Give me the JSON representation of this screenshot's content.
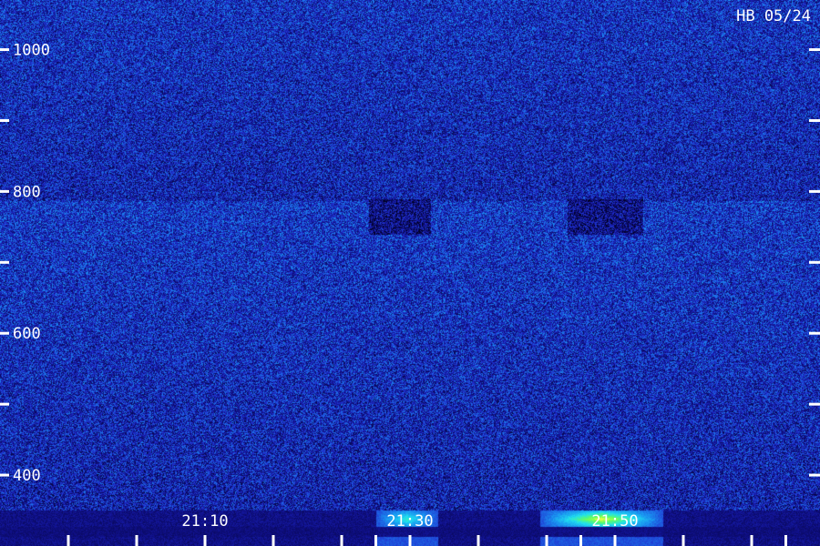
{
  "chart_data": {
    "type": "heatmap",
    "title": "",
    "station_label": "HB 05/24",
    "xlabel": "",
    "ylabel": "",
    "y_range": [
      300,
      1070
    ],
    "y_ticks": [
      {
        "value": 1000,
        "label": "1000"
      },
      {
        "value": 900,
        "label": ""
      },
      {
        "value": 800,
        "label": "800"
      },
      {
        "value": 700,
        "label": ""
      },
      {
        "value": 600,
        "label": "600"
      },
      {
        "value": 500,
        "label": ""
      },
      {
        "value": 400,
        "label": "400"
      }
    ],
    "x_range_minutes": [
      0,
      120
    ],
    "x_time_labels": [
      {
        "minute": 30,
        "label": "21:10"
      },
      {
        "minute": 60,
        "label": "21:30"
      },
      {
        "minute": 90,
        "label": "21:50"
      }
    ],
    "x_tick_minutes": [
      10,
      20,
      30,
      40,
      50,
      55,
      60,
      70,
      80,
      85,
      90,
      100,
      110,
      115
    ],
    "bright_bands": [
      {
        "start_minute": 55,
        "end_minute": 64,
        "intensity": 0.55
      },
      {
        "start_minute": 79,
        "end_minute": 97,
        "intensity": 1.0
      }
    ],
    "dark_bands": [
      {
        "start_minute": 54,
        "end_minute": 63,
        "y_low": 740,
        "y_high": 790
      },
      {
        "start_minute": 83,
        "end_minute": 94,
        "y_low": 740,
        "y_high": 790
      }
    ],
    "colormap": [
      "#000020",
      "#10108a",
      "#2030d0",
      "#1a8ff0",
      "#20e0f0",
      "#60ff60",
      "#ffff40"
    ]
  }
}
